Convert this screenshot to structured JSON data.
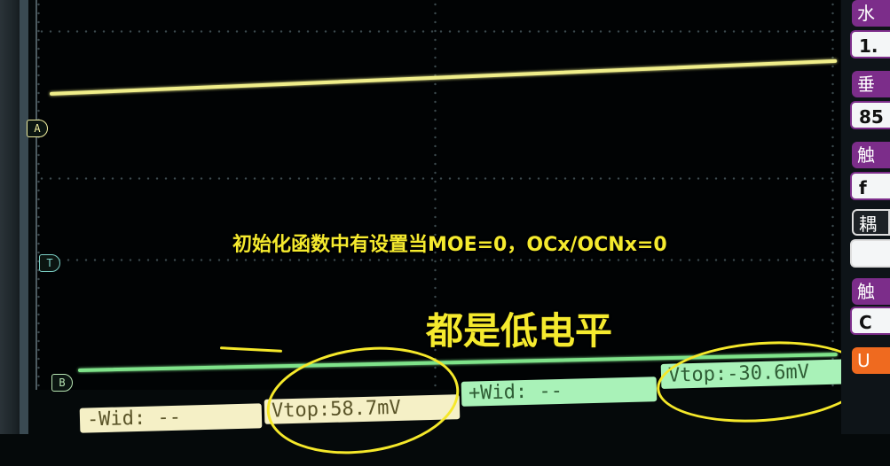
{
  "markers": {
    "a": "A",
    "t": "T",
    "b": "B"
  },
  "captions": {
    "line1": "初始化函数中有设置当MOE=0，OCx/OCNx=0",
    "line2": "都是低电平"
  },
  "measurements": {
    "neg_width": "-Wid: --",
    "vtop_ch1": "Vtop:58.7mV",
    "pos_width": "+Wid: --",
    "vtop_ch2": "Vtop:-30.6mV"
  },
  "right_panel": {
    "tab1": "水",
    "val1": "1.",
    "tab2": "垂",
    "val2": "85",
    "tab3": "触",
    "val3": "f",
    "tab4": "耦",
    "val4": "",
    "tab5": "触",
    "val5": "C",
    "tab6": "U"
  },
  "colors": {
    "trace_a": "#f0ee8a",
    "trace_b": "#7fe38a",
    "caption": "#f5ea2e",
    "annotation": "#f5e82a"
  }
}
